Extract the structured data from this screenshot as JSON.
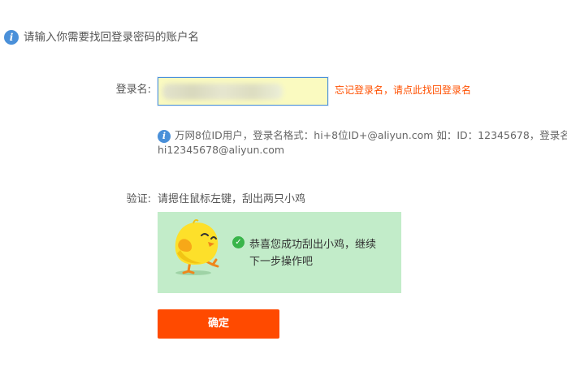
{
  "header": {
    "icon": "info-icon",
    "text": "请输入你需要找回登录密码的账户名"
  },
  "login": {
    "label": "登录名:",
    "forgot_link": "忘记登录名，请点此找回登录名"
  },
  "hint": {
    "icon": "info-icon",
    "line1": "万网8位ID用户，登录名格式：hi+8位ID+@aliyun.com 如：ID：12345678，登录名：",
    "line2": "hi12345678@aliyun.com"
  },
  "verify": {
    "label": "验证:",
    "instruction": "请摁住鼠标左键，刮出两只小鸡",
    "success_icon": "check-circle-icon",
    "success_text": "恭喜您成功刮出小鸡，继续下一步操作吧"
  },
  "confirm_label": "确定",
  "colors": {
    "accent": "#ff4a00",
    "link": "#ff5000",
    "info": "#4a90d9",
    "captcha_bg": "#c2ecc9",
    "success": "#39b54a",
    "input_bg": "#fafac0"
  }
}
